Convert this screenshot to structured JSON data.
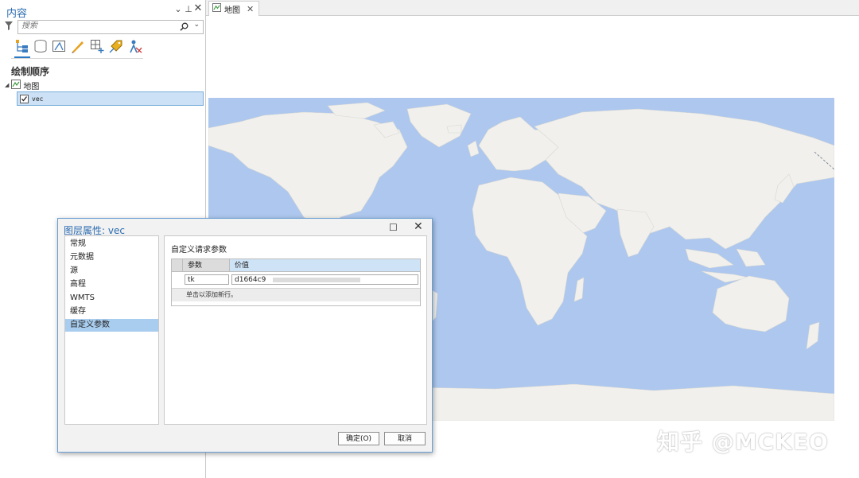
{
  "pane": {
    "title": "内容",
    "search_placeholder": "搜索",
    "section_title": "绘制顺序",
    "tree": {
      "map_label": "地图",
      "layer_label": "vec",
      "layer_checked": true
    },
    "tool_icons": [
      "list-by-drawing-order-icon",
      "list-by-data-source-icon",
      "list-by-selection-icon",
      "list-by-editing-icon",
      "list-by-snapping-icon",
      "list-by-labeling-icon",
      "list-by-perspective-icon"
    ]
  },
  "tab": {
    "label": "地图"
  },
  "dialog": {
    "title": "图层属性: vec",
    "nav_items": [
      "常规",
      "元数据",
      "源",
      "高程",
      "WMTS",
      "缓存",
      "自定义参数"
    ],
    "selected_nav": "自定义参数",
    "section_title": "自定义请求参数",
    "grid": {
      "headers": [
        "参数",
        "价值"
      ],
      "rows": [
        {
          "param": "tk",
          "value": "d1664c9"
        }
      ],
      "add_row_hint": "单击以添加新行。"
    },
    "ok_label": "确定(O)",
    "cancel_label": "取消"
  },
  "colors": {
    "ocean": "#adc7ee",
    "land": "#f1f0ec",
    "accent": "#2b6cb0",
    "selection": "#a9cdef"
  },
  "watermark": "知乎 @MCKEO"
}
